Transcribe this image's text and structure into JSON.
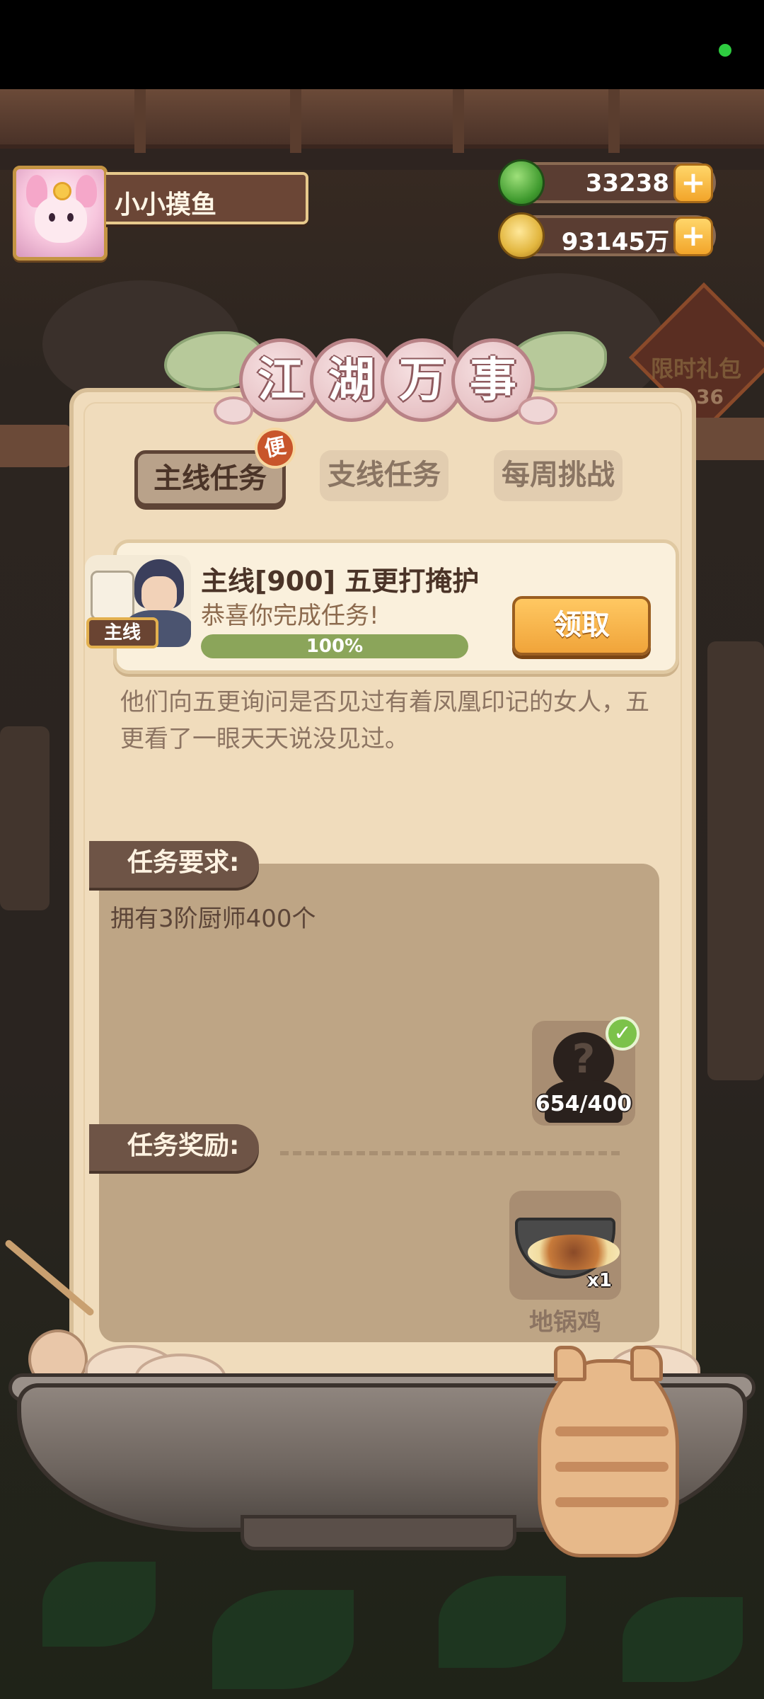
{
  "hud": {
    "player_name": "小小摸鱼",
    "jade_count": "33238",
    "coin_count": "93145万",
    "plus_label": "+"
  },
  "background": {
    "promo_label": "限时礼包",
    "promo_timer": "36"
  },
  "panel": {
    "title_chars": [
      "江",
      "湖",
      "万",
      "事"
    ],
    "tabs": [
      {
        "label": "主线任务",
        "active": true
      },
      {
        "label": "支线任务",
        "active": false
      },
      {
        "label": "每周挑战",
        "active": false
      }
    ],
    "tab_badge": "便",
    "quest": {
      "tag": "主线",
      "title": "主线[900] 五更打掩护",
      "subtitle": "恭喜你完成任务!",
      "progress": 1.0,
      "progress_text": "100%",
      "claim_label": "领取"
    },
    "story": "他们向五更询问是否见过有着凤凰印记的女人，五更看了一眼天天说没见过。",
    "requirement_label": "任务要求:",
    "requirement_text": "拥有3阶厨师400个",
    "requirement_item": {
      "icon": "?",
      "count": "654/400",
      "done_mark": "✓"
    },
    "reward_label": "任务奖励:",
    "reward_item": {
      "qty": "x1",
      "name": "地锅鸡"
    }
  },
  "colors": {
    "panel_bg": "#f0dcbc",
    "claim_button": "#f0a43a",
    "progress_fill": "#8ba55a",
    "label_bg": "#6e5446"
  }
}
